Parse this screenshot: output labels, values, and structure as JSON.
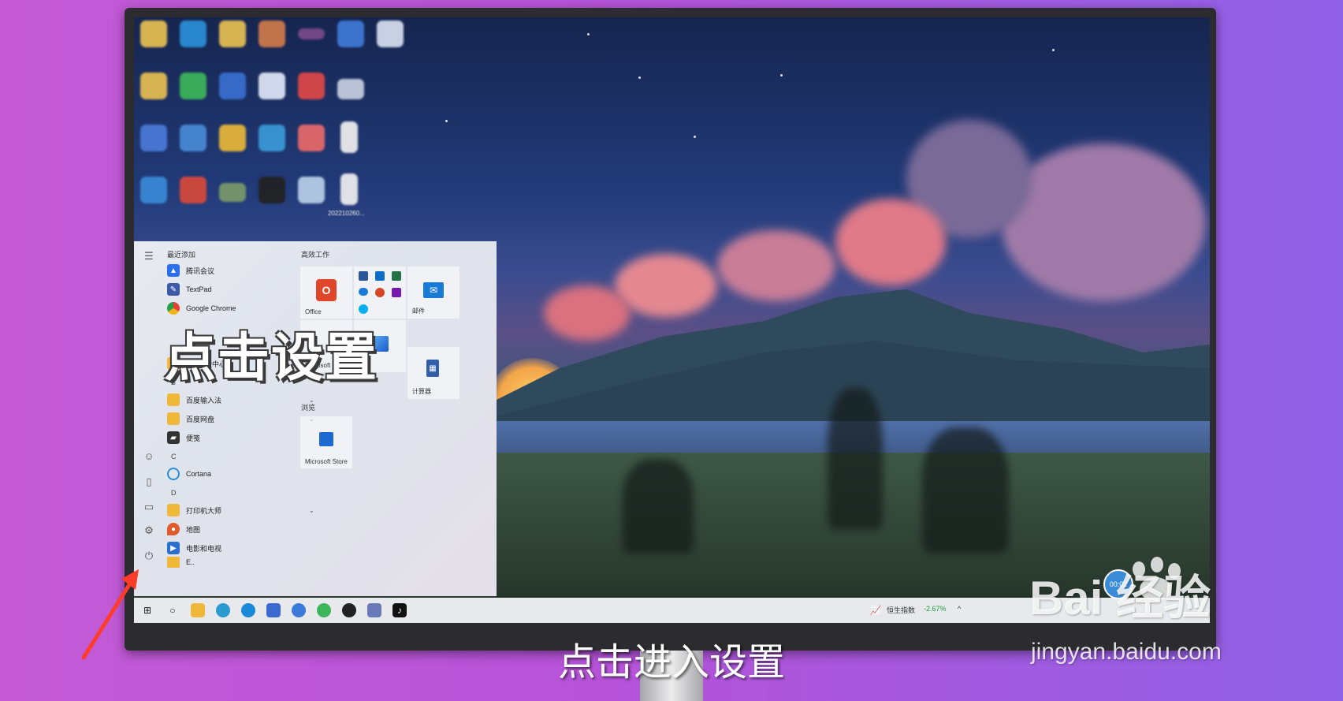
{
  "start_menu": {
    "recent_header": "最近添加",
    "recent_apps": [
      {
        "label": "腾讯会议",
        "color": "#2a6ff0"
      },
      {
        "label": "TextPad",
        "color": "#3c5aa8"
      },
      {
        "label": "Google Chrome",
        "color": "#e34133"
      }
    ],
    "partial_group_label": "360安全中心",
    "letter_b": "B",
    "b_apps": [
      {
        "label": "百度输入法",
        "chevron": "⌄"
      },
      {
        "label": "百度网盘",
        "chevron": "⌄"
      },
      {
        "label": "便笺",
        "chevron": ""
      }
    ],
    "letter_c": "C",
    "c_apps": [
      {
        "label": "Cortana"
      }
    ],
    "letter_d": "D",
    "d_apps": [
      {
        "label": "打印机大师",
        "chevron": "⌄"
      },
      {
        "label": "地图",
        "chevron": ""
      },
      {
        "label": "电影和电视",
        "chevron": ""
      },
      {
        "label": "E..",
        "chevron": "⌄"
      }
    ],
    "tiles_group1": "高效工作",
    "tile_office": "Office",
    "tile_mail": "邮件",
    "tile_edge": "Microsoft Edge",
    "tile_photos": "照片",
    "tile_calc": "计算器",
    "tiles_group2": "浏览",
    "tile_store": "Microsoft Store"
  },
  "taskbar": {
    "stock_name": "恒生指数",
    "stock_change": "-2.67%",
    "stock_color": "#1a9b3c",
    "tray_arrow": "^"
  },
  "desktop": {
    "partial_text": "202210260..."
  },
  "overlay": {
    "title": "点击设置",
    "caption": "点击进入设置",
    "bubble_text": "00:02"
  },
  "watermark": {
    "logo": "Bai  经验",
    "site": "jingyan.baidu.com"
  }
}
